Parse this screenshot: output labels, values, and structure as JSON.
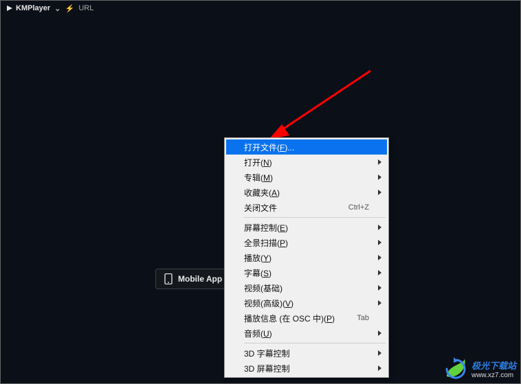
{
  "titlebar": {
    "brand_prefix": "K",
    "brand": "KMPlayer",
    "url_label": "URL"
  },
  "mobile": {
    "label": "Mobile App"
  },
  "menu": {
    "items": [
      {
        "label": "打开文件",
        "accel": "F",
        "suffix": "...",
        "shortcut": "",
        "sub": false,
        "hl": true
      },
      {
        "label": "打开",
        "accel": "N",
        "suffix": "",
        "shortcut": "",
        "sub": true
      },
      {
        "label": "专辑",
        "accel": "M",
        "suffix": "",
        "shortcut": "",
        "sub": true
      },
      {
        "label": "收藏夹",
        "accel": "A",
        "suffix": "",
        "shortcut": "",
        "sub": true
      },
      {
        "label": "关闭文件",
        "accel": "",
        "suffix": "",
        "shortcut": "Ctrl+Z",
        "sub": false
      },
      {
        "sep": true
      },
      {
        "label": "屏幕控制",
        "accel": "E",
        "suffix": "",
        "shortcut": "",
        "sub": true
      },
      {
        "label": "全景扫描",
        "accel": "P",
        "suffix": "",
        "shortcut": "",
        "sub": true
      },
      {
        "label": "播放",
        "accel": "Y",
        "suffix": "",
        "shortcut": "",
        "sub": true
      },
      {
        "label": "字幕",
        "accel": "S",
        "suffix": "",
        "shortcut": "",
        "sub": true
      },
      {
        "label": "视频(基础)",
        "accel": "",
        "suffix": "",
        "shortcut": "",
        "sub": true
      },
      {
        "label": "视频(高级)",
        "accel": "V",
        "suffix": "",
        "shortcut": "",
        "sub": true
      },
      {
        "label": "播放信息 (在 OSC 中)",
        "accel": "P",
        "suffix": "",
        "shortcut": "Tab",
        "sub": false
      },
      {
        "label": "音频",
        "accel": "U",
        "suffix": "",
        "shortcut": "",
        "sub": true
      },
      {
        "sep": true
      },
      {
        "label": "3D 字幕控制",
        "accel": "",
        "suffix": "",
        "shortcut": "",
        "sub": true
      },
      {
        "label": "3D 屏幕控制",
        "accel": "",
        "suffix": "",
        "shortcut": "",
        "sub": true
      }
    ]
  },
  "watermark": {
    "brand": "极光下载站",
    "url": "www.xz7.com"
  }
}
